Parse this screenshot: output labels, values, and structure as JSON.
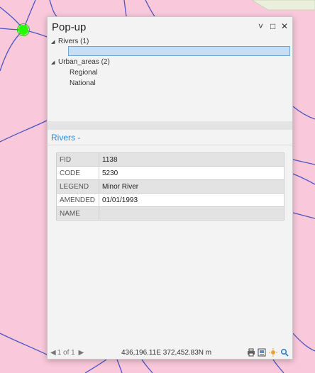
{
  "popup": {
    "title": "Pop-up",
    "window_controls": {
      "dropdown": "˅",
      "maximize": "□",
      "close": "✕"
    }
  },
  "tree": {
    "rivers_group": "Rivers (1)",
    "urban_group": "Urban_areas (2)",
    "urban_items": [
      "Regional",
      "National"
    ]
  },
  "details": {
    "header": "Rivers -",
    "rows": [
      {
        "key": "FID",
        "value": "1138"
      },
      {
        "key": "CODE",
        "value": "5230"
      },
      {
        "key": "LEGEND",
        "value": "Minor River"
      },
      {
        "key": "AMENDED",
        "value": "01/01/1993"
      },
      {
        "key": "NAME",
        "value": ""
      }
    ]
  },
  "footer": {
    "prev": "◀",
    "page": "1 of 1",
    "next": "▶",
    "coordinates": "436,196.11E 372,452.83N m"
  },
  "colors": {
    "map_background": "#f9c8da",
    "river_line": "#4b55c4",
    "selected_feature": "#22ff00",
    "header_accent": "#2a8ad6"
  },
  "icons": [
    "print-icon",
    "export-icon",
    "flash-icon",
    "zoom-to-icon"
  ]
}
